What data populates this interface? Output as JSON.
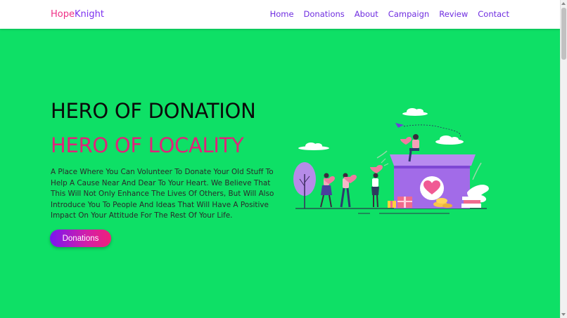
{
  "brand": {
    "part1": "Hope",
    "part2": "Knight"
  },
  "nav": {
    "items": [
      "Home",
      "Donations",
      "About",
      "Campaign",
      "Review",
      "Contact"
    ]
  },
  "hero": {
    "title_line1": "HERO OF DONATION",
    "title_line2": "HERO OF LOCALITY",
    "description": "A Place Where You Can Volunteer To Donate Your Old Stuff To Help A Cause Near And Dear To Your Heart. We Believe That This Will Not Only Enhance The Lives Of Others, But Will Also Introduce You To People And Ideas That Will Have A Positive Impact On Your Attitude For The Rest Of Your Life.",
    "cta_label": "Donations"
  },
  "colors": {
    "background": "#0ee066",
    "brand_pink": "#ef2f85",
    "brand_purple": "#7c2ff0",
    "title_pink": "#e0237a",
    "nav_purple": "#6f2de0"
  },
  "illustration": {
    "icon": "donation-box-illustration"
  }
}
